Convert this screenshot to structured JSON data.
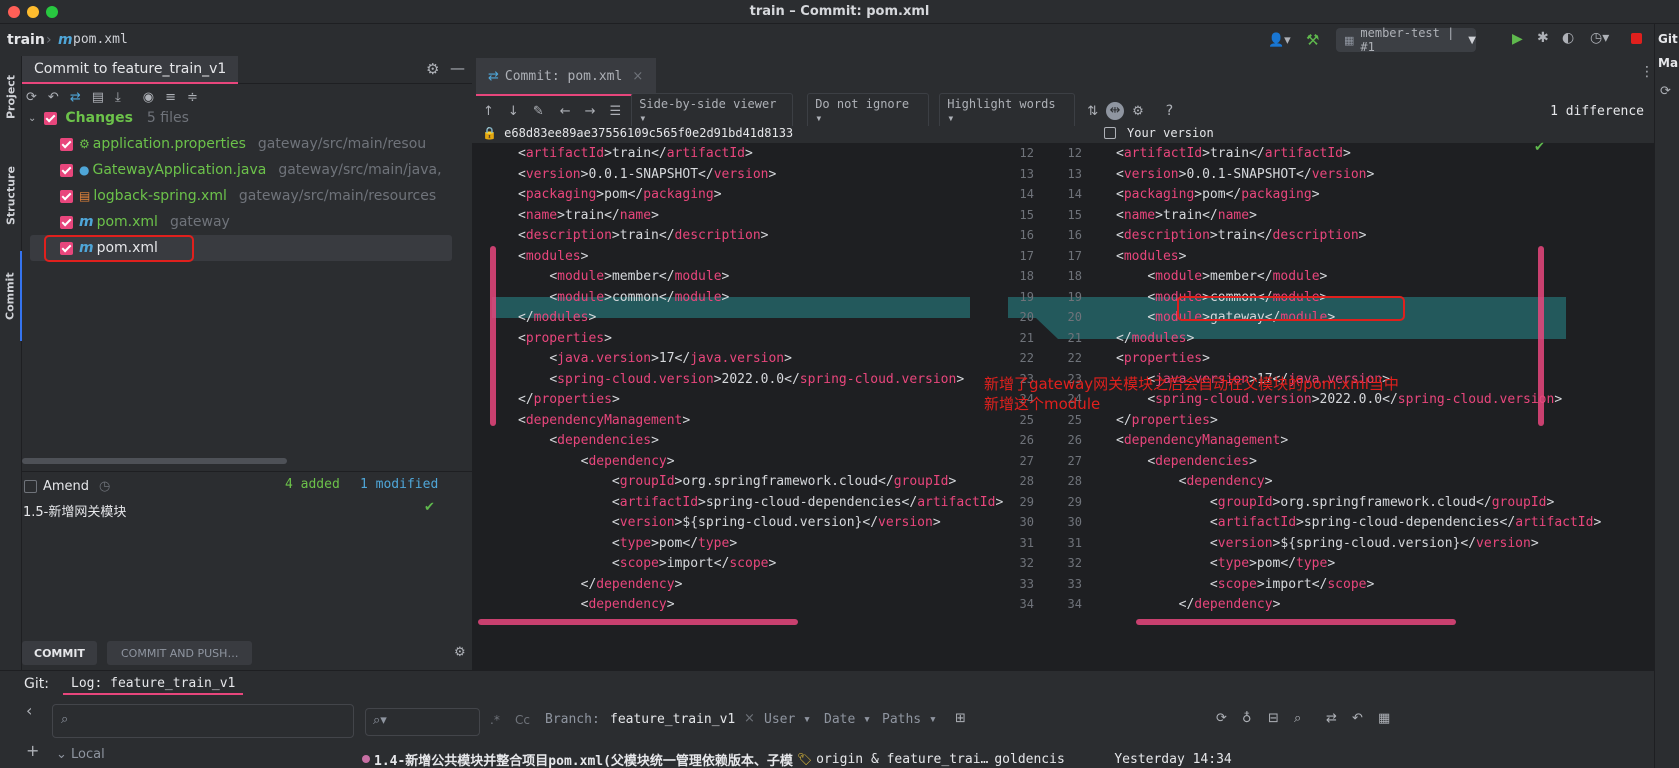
{
  "window": {
    "title": "train – Commit: pom.xml"
  },
  "navbar": {
    "project": "train",
    "file_icon": "m",
    "file": "pom.xml",
    "run_config": "member-test | #1"
  },
  "left_tabs": {
    "project": "Project",
    "structure": "Structure",
    "commit": "Commit"
  },
  "commit_panel": {
    "tab_label": "Commit to feature_train_v1",
    "changes_label": "Changes",
    "changes_count": "5 files",
    "files": [
      {
        "name": "application.properties",
        "path": "gateway/src/main/resou"
      },
      {
        "name": "GatewayApplication.java",
        "path": "gateway/src/main/java,"
      },
      {
        "name": "logback-spring.xml",
        "path": "gateway/src/main/resources"
      },
      {
        "name": "pom.xml",
        "path": "gateway"
      },
      {
        "name": "pom.xml",
        "path": ""
      }
    ],
    "amend_label": "Amend",
    "added": "4 added",
    "modified": "1 modified",
    "message": "1.5-新增网关模块",
    "commit_btn": "COMMIT",
    "commit_push_btn": "COMMIT AND PUSH…"
  },
  "diff": {
    "tab_label": "Commit: pom.xml",
    "viewer_select": "Side-by-side viewer",
    "ignore_select": "Do not ignore",
    "highlight_select": "Highlight words",
    "help": "?",
    "difference_count": "1 difference",
    "left_header": "e68d83ee89ae37556109c565f0e2d91bd41d8133",
    "right_header": "Your version",
    "annotation": [
      "新增了gateway网关模块之后会自动在父模块的pom.xml当中",
      "新增这个module"
    ]
  },
  "left_lines": [
    {
      "n": "12",
      "t": "<artifactId>train</artifactId>"
    },
    {
      "n": "13",
      "t": "<version>0.0.1-SNAPSHOT</version>"
    },
    {
      "n": "14",
      "t": "<packaging>pom</packaging>"
    },
    {
      "n": "15",
      "t": "<name>train</name>"
    },
    {
      "n": "16",
      "t": "<description>train</description>"
    },
    {
      "n": "17",
      "t": "<modules>"
    },
    {
      "n": "18",
      "t": "    <module>member</module>"
    },
    {
      "n": "19",
      "t": "    <module>common</module>"
    },
    {
      "n": "20",
      "t": "</modules>"
    },
    {
      "n": "21",
      "t": "<properties>"
    },
    {
      "n": "22",
      "t": "    <java.version>17</java.version>"
    },
    {
      "n": "23",
      "t": "    <spring-cloud.version>2022.0.0</spring-cloud.version>"
    },
    {
      "n": "24",
      "t": "</properties>"
    },
    {
      "n": "25",
      "t": "<dependencyManagement>"
    },
    {
      "n": "26",
      "t": "    <dependencies>"
    },
    {
      "n": "27",
      "t": "        <dependency>"
    },
    {
      "n": "28",
      "t": "            <groupId>org.springframework.cloud</groupId>"
    },
    {
      "n": "29",
      "t": "            <artifactId>spring-cloud-dependencies</artifactId>"
    },
    {
      "n": "30",
      "t": "            <version>${spring-cloud.version}</version>"
    },
    {
      "n": "31",
      "t": "            <type>pom</type>"
    },
    {
      "n": "32",
      "t": "            <scope>import</scope>"
    },
    {
      "n": "33",
      "t": "        </dependency>"
    },
    {
      "n": "34",
      "t": "        <dependency>"
    }
  ],
  "right_lines": [
    {
      "n": "12",
      "t": "<artifactId>train</artifactId>"
    },
    {
      "n": "13",
      "t": "<version>0.0.1-SNAPSHOT</version>"
    },
    {
      "n": "14",
      "t": "<packaging>pom</packaging>"
    },
    {
      "n": "15",
      "t": "<name>train</name>"
    },
    {
      "n": "16",
      "t": "<description>train</description>"
    },
    {
      "n": "17",
      "t": "<modules>"
    },
    {
      "n": "18",
      "t": "    <module>member</module>"
    },
    {
      "n": "19",
      "t": "    <module>common</module>"
    },
    {
      "n": "20",
      "t": "    <module>gateway</module>"
    },
    {
      "n": "21",
      "t": "</modules>"
    },
    {
      "n": "22",
      "t": "<properties>"
    },
    {
      "n": "23",
      "t": "    <java.version>17</java.version>"
    },
    {
      "n": "24",
      "t": "    <spring-cloud.version>2022.0.0</spring-cloud.version>"
    },
    {
      "n": "25",
      "t": "</properties>"
    },
    {
      "n": "26",
      "t": "<dependencyManagement>"
    },
    {
      "n": "27",
      "t": "    <dependencies>"
    },
    {
      "n": "28",
      "t": "        <dependency>"
    },
    {
      "n": "29",
      "t": "            <groupId>org.springframework.cloud</groupId>"
    },
    {
      "n": "30",
      "t": "            <artifactId>spring-cloud-dependencies</artifactId>"
    },
    {
      "n": "31",
      "t": "            <version>${spring-cloud.version}</version>"
    },
    {
      "n": "32",
      "t": "            <type>pom</type>"
    },
    {
      "n": "33",
      "t": "            <scope>import</scope>"
    },
    {
      "n": "34",
      "t": "        </dependency>"
    }
  ],
  "bottom": {
    "git_label": "Git:",
    "log_tab": "Log: feature_train_v1",
    "branch_label": "Branch:",
    "branch_value": "feature_train_v1",
    "user_filter": "User",
    "date_filter": "Date",
    "paths_filter": "Paths",
    "cc": "Cc",
    "local": "Local",
    "commit_msg": "1.4-新增公共模块并整合项目pom.xml(父模块统一管理依赖版本、子模",
    "refs": "origin & feature_trai…",
    "author": "goldencis",
    "time": "Yesterday 14:34"
  },
  "right_edge": {
    "git": "Git",
    "ma": "Ma"
  }
}
